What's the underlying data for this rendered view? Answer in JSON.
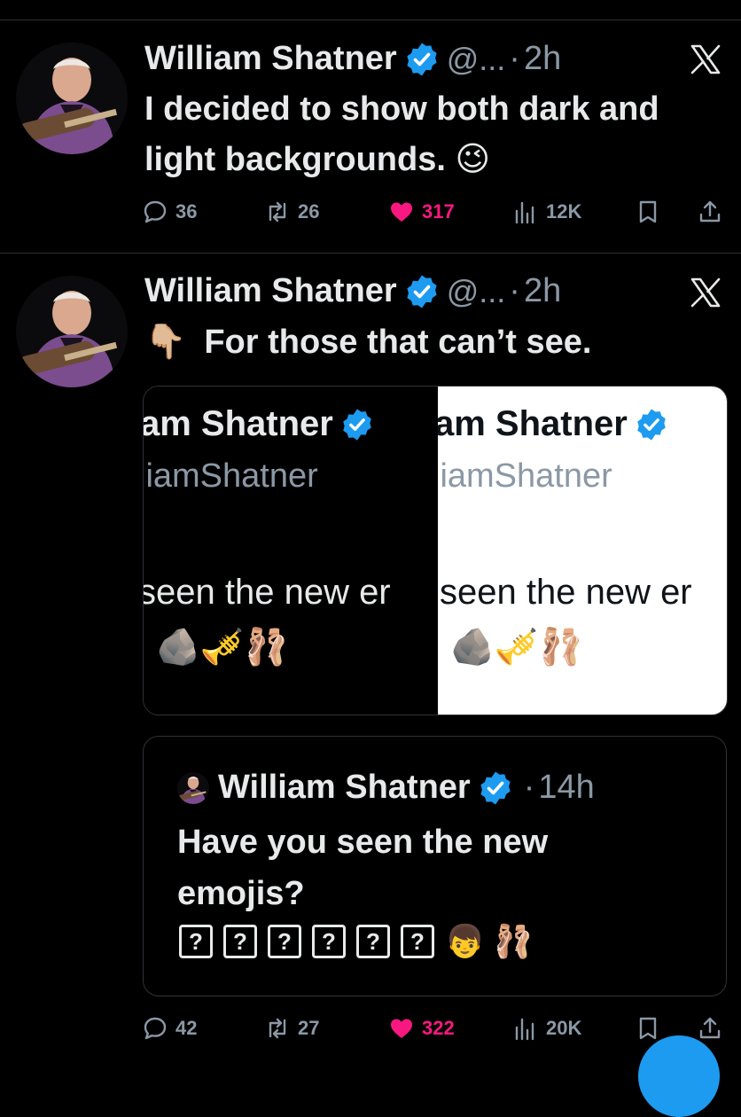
{
  "tweets": [
    {
      "name": "William Shatner",
      "handle": "@...",
      "sep": "·",
      "time": "2h",
      "text_line1": "I decided to show both dark and",
      "text_line2": "light backgrounds. 😉",
      "replies": "36",
      "retweets": "26",
      "likes": "317",
      "views": "12K"
    },
    {
      "name": "William Shatner",
      "handle": "@...",
      "sep": "·",
      "time": "2h",
      "text": "For those that can’t see.",
      "pointer_emoji": "👇🏼",
      "media": {
        "name_fragment": "am Shatner",
        "handle_fragment": "liamShatner",
        "line_fragment": "seen the new er",
        "emojis": "🪨🎺🩰",
        "left_theme": "dark",
        "right_theme": "light"
      },
      "quote": {
        "name": "William Shatner",
        "sep": "·",
        "time": "14h",
        "text_line1": "Have you seen the new",
        "text_line2": "emojis?",
        "tofu_glyph": "?",
        "tofu_count": 6,
        "trailing_emojis": [
          "👦",
          "🩰"
        ]
      },
      "replies": "42",
      "retweets": "27",
      "likes": "322",
      "views": "20K"
    }
  ],
  "icons": {
    "verified": "verified-badge-icon",
    "close": "x-logo-icon",
    "reply": "reply-icon",
    "retweet": "retweet-icon",
    "like": "heart-icon",
    "views": "views-icon",
    "bookmark": "bookmark-icon",
    "share": "share-icon"
  },
  "colors": {
    "background": "#000000",
    "text": "#e7e9ea",
    "muted": "#8b98a5",
    "like": "#f91880",
    "verified": "#1d9bf0",
    "border": "#2f3336"
  }
}
